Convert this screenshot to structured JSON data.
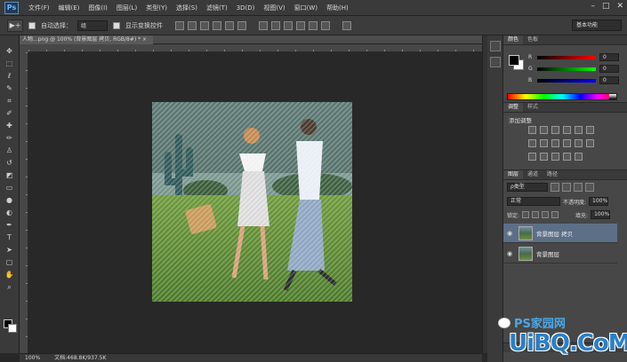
{
  "app": {
    "logo": "Ps",
    "menu": [
      "文件(F)",
      "编辑(E)",
      "图像(I)",
      "图层(L)",
      "类型(Y)",
      "选择(S)",
      "滤镜(T)",
      "3D(D)",
      "视图(V)",
      "窗口(W)",
      "帮助(H)"
    ],
    "window_controls": [
      "–",
      "□",
      "✕"
    ]
  },
  "options": {
    "tool_glyph": "▶+",
    "auto_select_label": "自动选择：",
    "auto_select_value": "组",
    "show_transform_label": "显示变换控件",
    "workspace": "基本功能"
  },
  "document": {
    "tab_label": "人物...png @ 100% (背景图层 拷贝, RGB/8#) * ×",
    "zoom": "100%",
    "doc_size": "文档:468.8K/937.5K"
  },
  "color_panel": {
    "tabs": [
      "颜色",
      "色板"
    ],
    "channels": [
      {
        "label": "R",
        "value": "0"
      },
      {
        "label": "G",
        "value": "0"
      },
      {
        "label": "B",
        "value": "0"
      }
    ]
  },
  "adjustments_panel": {
    "tabs": [
      "调整",
      "样式"
    ],
    "title": "添加调整"
  },
  "layers_panel": {
    "tabs": [
      "图层",
      "通道",
      "路径"
    ],
    "kind_label": "ρ类型",
    "blend_mode": "正常",
    "opacity_label": "不透明度:",
    "opacity_value": "100%",
    "lock_label": "锁定:",
    "fill_label": "填充:",
    "fill_value": "100%",
    "layers": [
      {
        "name": "背景图层 拷贝",
        "selected": true
      },
      {
        "name": "背景图层",
        "selected": false
      }
    ]
  },
  "watermark": {
    "line1": "PS家园网",
    "line2": "UiBQ.CoM"
  },
  "colors": {
    "accent_selected_layer": "#5c6f87",
    "watermark_blue": "#2b7fc6"
  }
}
